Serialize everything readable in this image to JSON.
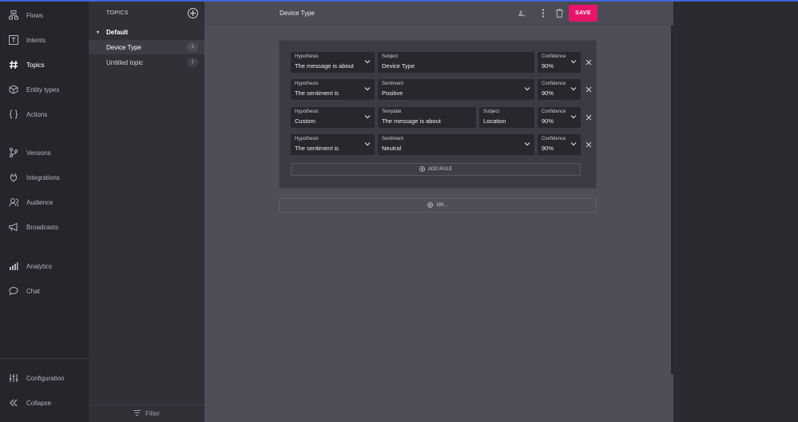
{
  "nav": {
    "items": [
      {
        "label": "Flows",
        "icon": "flows-icon"
      },
      {
        "label": "Intents",
        "icon": "intents-icon"
      },
      {
        "label": "Topics",
        "icon": "hash-icon"
      },
      {
        "label": "Entity types",
        "icon": "cube-icon"
      },
      {
        "label": "Actions",
        "icon": "braces-icon"
      },
      {
        "label": "Versions",
        "icon": "branch-icon"
      },
      {
        "label": "Integrations",
        "icon": "plug-icon"
      },
      {
        "label": "Audience",
        "icon": "audience-icon"
      },
      {
        "label": "Broadcasts",
        "icon": "megaphone-icon"
      },
      {
        "label": "Analytics",
        "icon": "bar-chart-icon"
      },
      {
        "label": "Chat",
        "icon": "chat-bubble-icon"
      },
      {
        "label": "Configuration",
        "icon": "sliders-icon"
      },
      {
        "label": "Collapse",
        "icon": "double-chevron-left-icon"
      }
    ],
    "active": "Topics"
  },
  "topics": {
    "heading": "TOPICS",
    "group": "Default",
    "items": [
      {
        "label": "Device Type",
        "count": "1"
      },
      {
        "label": "Untitled topic",
        "count": "1"
      }
    ],
    "filter_label": "Filter"
  },
  "header": {
    "title": "Device Type",
    "save_label": "SAVE"
  },
  "rules": [
    {
      "hypothesis": {
        "label": "Hypothesis",
        "value": "The message is about"
      },
      "subject": {
        "label": "Subject",
        "value": "Device Type"
      },
      "confidence": {
        "label": "Confidence",
        "value": "90%"
      }
    },
    {
      "hypothesis": {
        "label": "Hypothesis",
        "value": "The sentiment is"
      },
      "sentiment": {
        "label": "Sentiment",
        "value": "Positive"
      },
      "confidence": {
        "label": "Confidence",
        "value": "90%"
      }
    },
    {
      "hypothesis": {
        "label": "Hypothesis",
        "value": "Custom"
      },
      "template": {
        "label": "Template",
        "value": "The message is about"
      },
      "subject": {
        "label": "Subject",
        "value": "Location"
      },
      "confidence": {
        "label": "Confidence",
        "value": "90%"
      }
    },
    {
      "hypothesis": {
        "label": "Hypothesis",
        "value": "The sentiment is"
      },
      "sentiment": {
        "label": "Sentiment",
        "value": "Neutral"
      },
      "confidence": {
        "label": "Confidence",
        "value": "90%"
      }
    }
  ],
  "add_rule_label": "ADD RULE",
  "or_label": "OR...",
  "colors": {
    "accent": "#e6146b",
    "topbar": "#3f63d8"
  }
}
